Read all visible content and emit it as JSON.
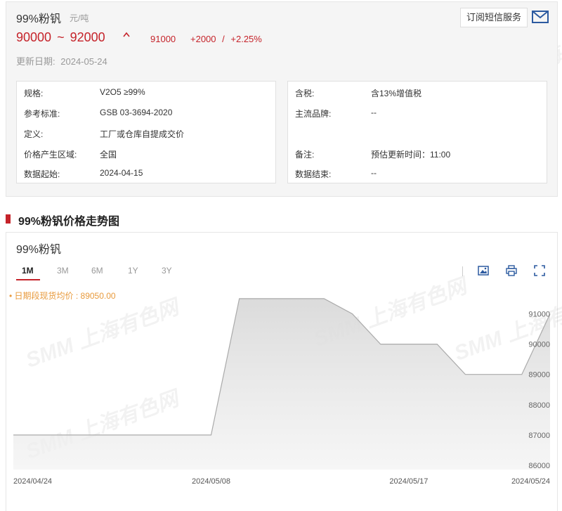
{
  "product": {
    "name": "99%粉钒",
    "unit": "元/吨",
    "price_low": "90000",
    "tilde": "~",
    "price_high": "92000",
    "price_mid": "91000",
    "change": "+2000",
    "sep": "/",
    "change_pct": "+2.25%",
    "update_label": "更新日期:",
    "update_date": "2024-05-24",
    "subscribe_label": "订阅短信服务"
  },
  "info_left": [
    {
      "key": "规格:",
      "value": "V2O5 ≥99%"
    },
    {
      "key": "参考标准:",
      "value": "GSB 03-3694-2020"
    },
    {
      "key": "定义:",
      "value": "工厂或仓库自提成交价"
    },
    {
      "key": "价格产生区域:",
      "value": "全国"
    },
    {
      "key": "数据起始:",
      "value": "2024-04-15"
    }
  ],
  "info_right": [
    {
      "key": "含税:",
      "value": "含13%增值税"
    },
    {
      "key": "主流品牌:",
      "value": "--"
    },
    {
      "key": "备注:",
      "value": "预估更新时间：11:00"
    },
    {
      "key": "数据结束:",
      "value": "--"
    }
  ],
  "section_title": "99%粉钒价格走势图",
  "chart_panel": {
    "name": "99%粉钒",
    "tabs": [
      "1M",
      "3M",
      "6M",
      "1Y",
      "3Y"
    ],
    "active_tab": "1M",
    "avg_label": "• 日期段现货均价 : 89050.00"
  },
  "watermark": "SMM 上海有色网",
  "colors": {
    "accent": "#c5232a",
    "avg_label": "#e89a3c",
    "line": "#aaaaaa"
  },
  "icons": [
    "mail-icon",
    "image-icon",
    "print-icon",
    "fullscreen-icon",
    "price-up-icon"
  ],
  "chart_data": {
    "type": "area",
    "title": "",
    "x": [
      "2024/04/24",
      "2024/04/25",
      "2024/04/26",
      "2024/04/29",
      "2024/04/30",
      "2024/05/06",
      "2024/05/07",
      "2024/05/08",
      "2024/05/09",
      "2024/05/10",
      "2024/05/13",
      "2024/05/14",
      "2024/05/15",
      "2024/05/16",
      "2024/05/17",
      "2024/05/20",
      "2024/05/21",
      "2024/05/22",
      "2024/05/23",
      "2024/05/24"
    ],
    "series": [
      {
        "values": [
          87000,
          87000,
          87000,
          87000,
          87000,
          87000,
          87000,
          87000,
          91500,
          91500,
          91500,
          91500,
          91000,
          90000,
          90000,
          90000,
          89000,
          89000,
          89000,
          91000
        ]
      }
    ],
    "x_ticks": [
      "2024/04/24",
      "2024/05/08",
      "2024/05/17",
      "2024/05/24"
    ],
    "y_ticks": [
      86000,
      87000,
      88000,
      89000,
      90000,
      91000
    ],
    "ylim": [
      86000,
      91500
    ],
    "grid": false,
    "legend": "none"
  }
}
